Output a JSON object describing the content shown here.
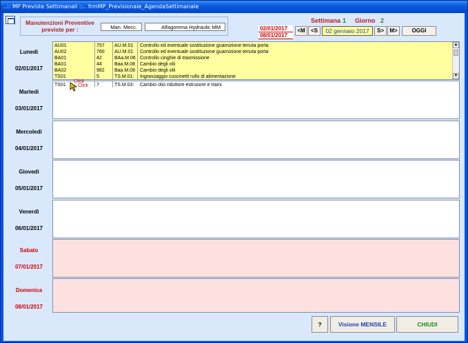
{
  "window": {
    "title": "..:: MP Previste Settimanali ::..   frmMP_Previsionale_AgendaSettimanale"
  },
  "filter": {
    "label": "Manutenzioni Preventive previste per :",
    "category": "Man. Mecc.",
    "machine": "Alfagomma Hydraulic  MM"
  },
  "week": {
    "settimana_label": "Settimana",
    "settimana_value": "1",
    "giorno_label": "Giorno",
    "giorno_value": "2",
    "date_from": "02/01/2017",
    "date_to": "08/01/2017",
    "current_date": "02 gennaio 2017"
  },
  "nav": {
    "prev_month": "<M",
    "prev_week": "<S",
    "next_week": "S>",
    "next_month": "M>",
    "today": "OGGI"
  },
  "days": [
    {
      "name": "Lunedì",
      "date": "02/01/2017",
      "weekend": false,
      "rows": [
        {
          "code": "AU01",
          "num": "757",
          "ref": "AU.M.01",
          "desc": "Controllo ed eventuale sostituzione guarnizione tenuta porta"
        },
        {
          "code": "AU02",
          "num": "760",
          "ref": "AU.M.01",
          "desc": "Controllo ed eventuale sostituzione guarnizione tenuta porta"
        },
        {
          "code": "BA01",
          "num": "42",
          "ref": "BAa.M.06",
          "desc": "Controllo cinghie di trasmissione"
        },
        {
          "code": "BA01",
          "num": "44",
          "ref": "Baa.M.08",
          "desc": "Cambio degli olii"
        },
        {
          "code": "BA02",
          "num": "982",
          "ref": "Baa.M.08",
          "desc": "Cambio degli olii"
        },
        {
          "code": "TS01",
          "num": "5",
          "ref": "TS.M.01:",
          "desc": "Ingrassaggio cuscinetti rullo di alimentazione"
        }
      ]
    },
    {
      "name": "Martedì",
      "date": "03/01/2017",
      "weekend": false,
      "rows": [
        {
          "code": "TS01",
          "num": "7",
          "ref": "TS.M.03:",
          "desc": "Cambio olio riduttore estrusore e traini"
        }
      ]
    },
    {
      "name": "Mercoledì",
      "date": "04/01/2017",
      "weekend": false,
      "rows": []
    },
    {
      "name": "Giovedì",
      "date": "05/01/2017",
      "weekend": false,
      "rows": []
    },
    {
      "name": "Venerdì",
      "date": "06/01/2017",
      "weekend": false,
      "rows": []
    },
    {
      "name": "Sabato",
      "date": "07/01/2017",
      "weekend": true,
      "rows": []
    },
    {
      "name": "Domenica",
      "date": "08/01/2017",
      "weekend": true,
      "rows": []
    }
  ],
  "cursor": {
    "hint1": "Click",
    "hint2": "Click"
  },
  "footer": {
    "help": "?",
    "monthly_view": "Visione MENSILE",
    "close": "CHIUDI"
  }
}
